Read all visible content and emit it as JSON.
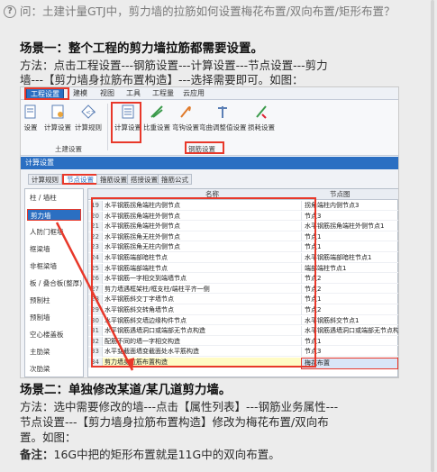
{
  "question": {
    "icon": "?",
    "text": "问：土建计量GTJ中，剪力墙的拉筋如何设置梅花布置/双向布置/矩形布置？"
  },
  "scene1": {
    "heading": "场景一：整个工程的剪力墙拉筋都需要设置。",
    "line1": "方法：点击工程设置---钢筋设置---计算设置---节点设置---剪力",
    "line2": "墙---【剪力墙身拉筋布置构造】---选择需要即可。如图："
  },
  "screenshot": {
    "ribbon_tabs": [
      "工程设置",
      "建模",
      "视图",
      "工具",
      "工程量",
      "云应用"
    ],
    "ribbon_buttons": [
      "设置",
      "计算设置",
      "计算规则",
      "计算设置",
      "比重设置",
      "弯钩设置",
      "弯曲调整值设置",
      "损耗设置"
    ],
    "ribbon_groups": [
      "土建设置",
      "钢筋设置"
    ],
    "dialog_title": "计算设置",
    "dialog_tabs": [
      "计算规则",
      "节点设置",
      "箍筋设置",
      "搭接设置",
      "箍筋公式"
    ],
    "left_items": [
      "柱 / 墙柱",
      "剪力墙",
      "人防门框墙",
      "框梁墙",
      "非框梁墙",
      "板 / 叠合板(整厚)",
      "预制柱",
      "预制墙",
      "空心楼盖板",
      "主肋梁",
      "次肋梁"
    ],
    "grid_header": {
      "name": "名称",
      "value": "节点图"
    },
    "rows": [
      {
        "num": "19",
        "name": "水平钢筋拐角端柱内侧节点",
        "value": "拐角端柱内侧节点3"
      },
      {
        "num": "20",
        "name": "水平钢筋拐角端柱外侧节点",
        "value": "节点3"
      },
      {
        "num": "21",
        "name": "水平钢筋拐角端柱外侧节点",
        "value": "水平钢筋拐角端柱外侧节点1"
      },
      {
        "num": "22",
        "name": "水平钢筋拐角无柱外侧节点",
        "value": "节点1"
      },
      {
        "num": "23",
        "name": "水平钢筋拐角无柱内侧节点",
        "value": "节点1"
      },
      {
        "num": "24",
        "name": "水平钢筋端部暗柱节点",
        "value": "水平钢筋端部暗柱节点1"
      },
      {
        "num": "25",
        "name": "水平钢筋端部端柱节点",
        "value": "端部端柱节点1"
      },
      {
        "num": "26",
        "name": "水平钢筋一字相交到端墙节点",
        "value": "节点2"
      },
      {
        "num": "27",
        "name": "剪力墙遇框架柱/框支柱/端柱平齐一侧",
        "value": "节点2"
      },
      {
        "num": "28",
        "name": "水平钢筋斜交丁字墙节点",
        "value": "节点1"
      },
      {
        "num": "29",
        "name": "水平钢筋斜交转角墙节点",
        "value": "节点2"
      },
      {
        "num": "30",
        "name": "水平钢筋斜交墙边缘构件节点",
        "value": "水平钢筋斜交节点1"
      },
      {
        "num": "31",
        "name": "水平钢筋遇墙洞口或端部无节点构造",
        "value": "水平钢筋遇墙洞口或端部无节点构造1"
      },
      {
        "num": "32",
        "name": "配筋不同的墙一字相交构造",
        "value": "节点1"
      },
      {
        "num": "33",
        "name": "水平变截面墙变截面处水平筋构造",
        "value": "节点3"
      },
      {
        "num": "34",
        "name": "剪力墙身拉筋布置构造",
        "value": "梅花布置"
      }
    ]
  },
  "scene2": {
    "heading": "场景二：单独修改某道/某几道剪力墙。",
    "line1": "方法：选中需要修改的墙---点击【属性列表】---钢筋业务属性---",
    "line2": "节点设置---【剪力墙身拉筋布置构造】修改为梅花布置/双向布",
    "line3": "置。如图：",
    "note_label": "备注：",
    "note_text": "16G中把的矩形布置就是11G中的双向布置。"
  },
  "colors": {
    "accent": "#2b6fc2",
    "highlight_red": "#e8382a",
    "row_yellow": "#fffbc4"
  }
}
